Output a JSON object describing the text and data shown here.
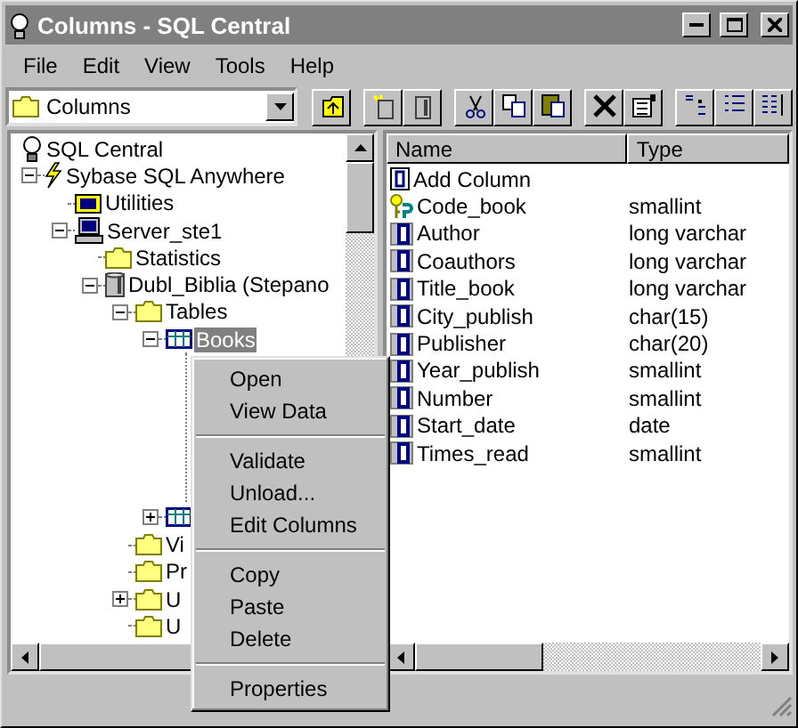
{
  "window": {
    "title": "Columns - SQL Central"
  },
  "menu_bar": [
    {
      "label": "File"
    },
    {
      "label": "Edit"
    },
    {
      "label": "View"
    },
    {
      "label": "Tools"
    },
    {
      "label": "Help"
    }
  ],
  "toolbar": {
    "location": {
      "value": "Columns"
    },
    "buttons": [
      {
        "kind": "up"
      },
      {
        "kind": "db-new"
      },
      {
        "kind": "db-stop"
      },
      {
        "kind": "cut"
      },
      {
        "kind": "copy"
      },
      {
        "kind": "paste"
      },
      {
        "kind": "delete"
      },
      {
        "kind": "properties"
      },
      {
        "kind": "small-icons"
      },
      {
        "kind": "list-view"
      },
      {
        "kind": "details"
      }
    ]
  },
  "tree": [
    {
      "label": "SQL Central",
      "kind": "central",
      "expanded": true,
      "selected": false,
      "children": [
        {
          "label": "Sybase SQL Anywhere",
          "kind": "bolt",
          "expanded": true,
          "selected": false,
          "children": [
            {
              "label": "Utilities",
              "kind": "tools",
              "expanded": false,
              "selected": false
            },
            {
              "label": "Server_ste1",
              "kind": "server",
              "expanded": true,
              "selected": false,
              "children": [
                {
                  "label": "Statistics",
                  "kind": "folder",
                  "expanded": false,
                  "selected": false
                },
                {
                  "label": "Dubl_Biblia (Stepano",
                  "kind": "database",
                  "expanded": true,
                  "selected": false,
                  "children": [
                    {
                      "label": "Tables",
                      "kind": "folder",
                      "expanded": true,
                      "selected": false,
                      "children": [
                        {
                          "label": "Books",
                          "kind": "table",
                          "expanded": true,
                          "selected": true
                        },
                        {
                          "kind": "table",
                          "expanded": false,
                          "has_children": true
                        }
                      ]
                    },
                    {
                      "label": "Vi",
                      "kind": "folder",
                      "expanded": false,
                      "selected": false
                    },
                    {
                      "label": "Pr",
                      "kind": "folder",
                      "expanded": false,
                      "selected": false
                    },
                    {
                      "label": "U",
                      "kind": "folder",
                      "expanded": false,
                      "has_children": true,
                      "selected": false
                    },
                    {
                      "label": "U",
                      "kind": "folder",
                      "expanded": false,
                      "selected": false
                    }
                  ]
                }
              ]
            }
          ]
        }
      ]
    }
  ],
  "list": {
    "columns": [
      "Name",
      "Type"
    ],
    "rows": [
      {
        "name": "Add Column",
        "kind": "add"
      },
      {
        "name": "Code_book",
        "type": "smallint",
        "kind": "key"
      },
      {
        "name": "Author",
        "type": "long varchar",
        "kind": "column"
      },
      {
        "name": "Coauthors",
        "type": "long varchar",
        "kind": "column"
      },
      {
        "name": "Title_book",
        "type": "long varchar",
        "kind": "column"
      },
      {
        "name": "City_publish",
        "type": "char(15)",
        "kind": "column"
      },
      {
        "name": "Publisher",
        "type": "char(20)",
        "kind": "column"
      },
      {
        "name": "Year_publish",
        "type": "smallint",
        "kind": "column"
      },
      {
        "name": "Number",
        "type": "smallint",
        "kind": "column"
      },
      {
        "name": "Start_date",
        "type": "date",
        "kind": "column"
      },
      {
        "name": "Times_read",
        "type": "smallint",
        "kind": "column"
      }
    ]
  },
  "context_menu": {
    "groups": [
      [
        "Open",
        "View Data"
      ],
      [
        "Validate",
        "Unload...",
        "Edit Columns"
      ],
      [
        "Copy",
        "Paste",
        "Delete"
      ],
      [
        "Properties"
      ]
    ]
  }
}
